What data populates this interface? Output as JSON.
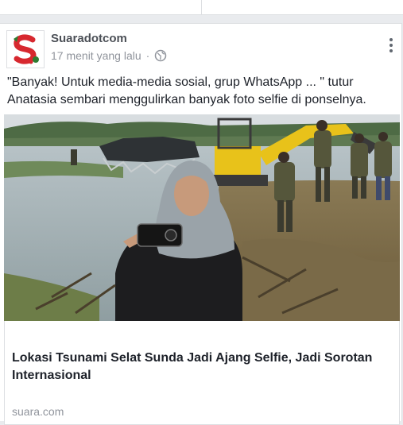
{
  "post": {
    "author": "Suaradotcom",
    "timestamp": "17 menit yang lalu",
    "separator": "·",
    "privacy_icon": "globe-icon",
    "more_icon": "more-vertical-icon",
    "caption": "\"Banyak! Untuk media-media sosial, grup WhatsApp ... \" tutur Anatasia sembari menggulirkan banyak foto selfie di ponselnya."
  },
  "link_preview": {
    "title": "Lokasi Tsunami Selat Sunda Jadi Ajang Selfie, Jadi Sorotan Internasional",
    "domain": "suara.com"
  },
  "colors": {
    "page_bg": "#e9ebee",
    "card_bg": "#ffffff",
    "text_primary": "#1d2129",
    "text_secondary": "#90949c",
    "author": "#4b4f56",
    "logo_red": "#d7282f",
    "excavator_yellow": "#e8c21a"
  }
}
